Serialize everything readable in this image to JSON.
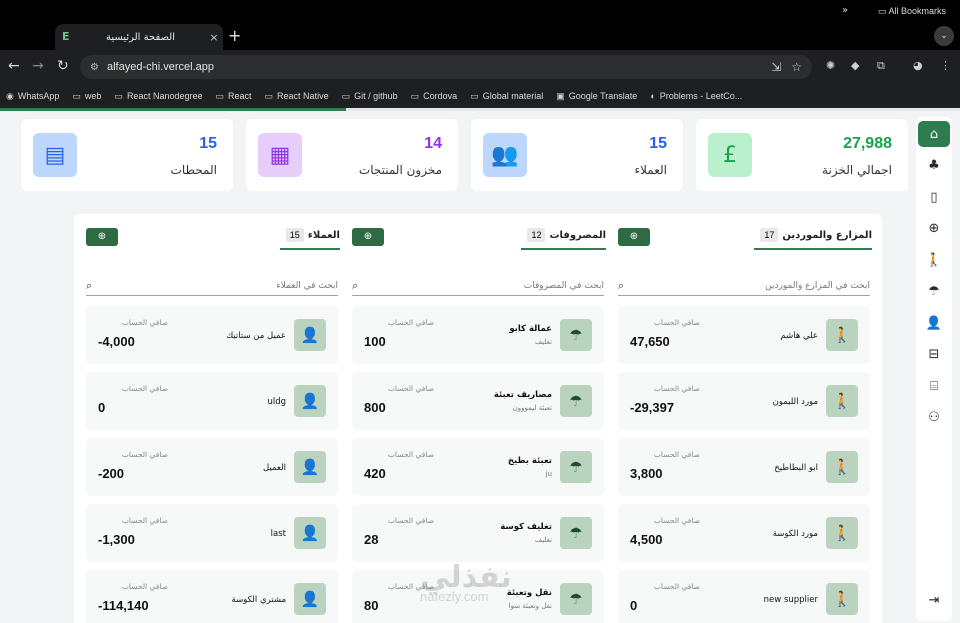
{
  "browser": {
    "tab_title": "الصفحة الرئيسية",
    "tab_favicon": "E",
    "tab_close": "×",
    "new_tab": "+",
    "url": "alfayed-chi.vercel.app",
    "bookmarks": [
      {
        "icon": "whatsapp-icon",
        "glyph": "◉",
        "label": "WhatsApp"
      },
      {
        "icon": "folder-icon",
        "glyph": "▭",
        "label": "web"
      },
      {
        "icon": "folder-icon",
        "glyph": "▭",
        "label": "React Nanodegree"
      },
      {
        "icon": "folder-icon",
        "glyph": "▭",
        "label": "React"
      },
      {
        "icon": "folder-icon",
        "glyph": "▭",
        "label": "React Native"
      },
      {
        "icon": "folder-icon",
        "glyph": "▭",
        "label": "Git / github"
      },
      {
        "icon": "folder-icon",
        "glyph": "▭",
        "label": "Cordova"
      },
      {
        "icon": "folder-icon",
        "glyph": "▭",
        "label": "Global material"
      },
      {
        "icon": "google-translate-icon",
        "glyph": "▣",
        "label": "Google Translate"
      },
      {
        "icon": "leetcode-icon",
        "glyph": "◐",
        "label": "Problems - LeetCo..."
      }
    ],
    "bookmarks_more": "»",
    "all_bookmarks": "All Bookmarks"
  },
  "stats": [
    {
      "value": "27,988",
      "label": "اجمالي الخزنة",
      "icon": "pound-icon",
      "glyph": "£",
      "color": "#16a34a",
      "bg": "#bbf0cf"
    },
    {
      "value": "15",
      "label": "العملاء",
      "icon": "users-icon",
      "glyph": "👥",
      "color": "#2563eb",
      "bg": "#bcd7fb"
    },
    {
      "value": "14",
      "label": "مخزون المنتجات",
      "icon": "boxes-icon",
      "glyph": "▦",
      "color": "#9333ea",
      "bg": "#e6cdfa"
    },
    {
      "value": "15",
      "label": "المحطات",
      "icon": "station-icon",
      "glyph": "▤",
      "color": "#2563eb",
      "bg": "#bcd7fb"
    }
  ],
  "balance_label": "صافي الحساب",
  "columns": [
    {
      "title": "المزارع والموردين",
      "count": "17",
      "search_placeholder": "ابحث في المزارع والموردين",
      "avatar_glyph": "🚶",
      "items": [
        {
          "name": "علي هاشم",
          "sub": "",
          "balance": "47,650"
        },
        {
          "name": "مورد الليمون",
          "sub": "",
          "balance": "-29,397"
        },
        {
          "name": "ابو البطاطيخ",
          "sub": "",
          "balance": "3,800"
        },
        {
          "name": "مورد الكوسة",
          "sub": "",
          "balance": "4,500"
        },
        {
          "name": "new supplier",
          "sub": "",
          "balance": "0"
        }
      ]
    },
    {
      "title": "المصروفات",
      "count": "12",
      "search_placeholder": "ابحث في المصروفات",
      "avatar_glyph": "☂",
      "items": [
        {
          "name": "عمالة كابو",
          "sub": "تغليف",
          "balance": "100"
        },
        {
          "name": "مصاريف تعبئة",
          "sub": "تعبئة ليمووون",
          "balance": "800"
        },
        {
          "name": "تعبئة بطيخ",
          "sub": "ju",
          "balance": "420"
        },
        {
          "name": "تغليف كوسة",
          "sub": "تغليف",
          "balance": "28"
        },
        {
          "name": "نقل وتعبئة",
          "sub": "نقل وتعبئة سوا",
          "balance": "80"
        }
      ]
    },
    {
      "title": "العملاء",
      "count": "15",
      "search_placeholder": "ابحث في العملاء",
      "avatar_glyph": "👤",
      "items": [
        {
          "name": "عميل من ستاتيك",
          "sub": "",
          "balance": "-4,000"
        },
        {
          "name": "uldg",
          "sub": "",
          "balance": "0"
        },
        {
          "name": "العميل",
          "sub": "",
          "balance": "-200"
        },
        {
          "name": "last",
          "sub": "",
          "balance": "-1,300"
        },
        {
          "name": "مشتري الكوسة",
          "sub": "",
          "balance": "-114,140"
        }
      ]
    }
  ],
  "sidebar": [
    {
      "icon": "home-icon",
      "glyph": "⌂"
    },
    {
      "icon": "tree-icon",
      "glyph": "♣"
    },
    {
      "icon": "station-icon",
      "glyph": "▯"
    },
    {
      "icon": "add-circle-icon",
      "glyph": "⊕"
    },
    {
      "icon": "farmer-icon",
      "glyph": "🚶"
    },
    {
      "icon": "umbrella-icon",
      "glyph": "☂"
    },
    {
      "icon": "user-icon",
      "glyph": "👤"
    },
    {
      "icon": "inbox-icon",
      "glyph": "⊟"
    },
    {
      "icon": "bank-icon",
      "glyph": "⌸"
    },
    {
      "icon": "group-icon",
      "glyph": "⚇"
    }
  ],
  "logout_glyph": "⇥",
  "watermark": {
    "ar": "نفذلي",
    "en": "nafezly.com"
  }
}
